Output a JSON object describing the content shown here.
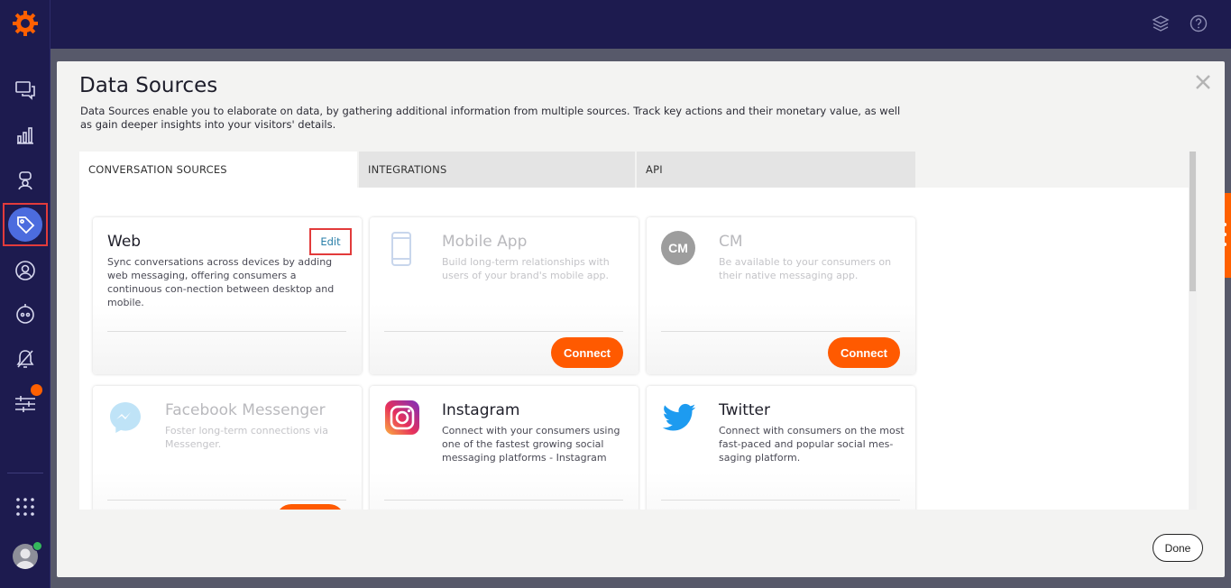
{
  "modal": {
    "title": "Data Sources",
    "description": "Data Sources enable you to elaborate on data, by gathering additional information from multiple sources. Track key actions and their monetary value, as well as gain deeper insights into your visitors' details.",
    "tabs": [
      {
        "label": "CONVERSATION SOURCES",
        "active": true
      },
      {
        "label": "INTEGRATIONS",
        "active": false
      },
      {
        "label": "API",
        "active": false
      }
    ],
    "done_label": "Done"
  },
  "cards": [
    {
      "title": "Web",
      "description": "Sync conversations across devices by adding web messaging, offering consumers a continuous con-nection between desktop and mobile.",
      "action": "Edit",
      "icon": "web-icon",
      "enabled": true
    },
    {
      "title": "Mobile App",
      "description": "Build long-term relationships with users of your brand's mobile app.",
      "action": "Connect",
      "icon": "mobile-phone-icon",
      "enabled": false
    },
    {
      "title": "CM",
      "description": "Be available to your consumers on their native messaging app.",
      "action": "Connect",
      "icon": "cm-logo-icon",
      "icon_text": "CM",
      "enabled": false
    },
    {
      "title": "Facebook Messenger",
      "description": "Foster long-term connections via Messenger.",
      "icon": "messenger-icon",
      "enabled": false
    },
    {
      "title": "Instagram",
      "description": "Connect with your consumers using one of the fastest growing social messaging platforms - Instagram",
      "icon": "instagram-icon",
      "enabled": true
    },
    {
      "title": "Twitter",
      "description": "Connect with consumers on the most fast-paced and popular social mes-saging platform.",
      "icon": "twitter-icon",
      "enabled": true
    }
  ],
  "sidebar": {
    "items": [
      "conversations-icon",
      "analytics-icon",
      "agent-icon",
      "tag-icon",
      "user-icon",
      "bot-icon",
      "automation-icon",
      "settings-sliders-icon",
      "apps-grid-icon"
    ],
    "active": "tag-icon"
  },
  "colors": {
    "sidebar": "#1d1b4f",
    "accent": "#ff5a00",
    "active_item": "#4c6cde",
    "highlight": "#e23b3b"
  }
}
